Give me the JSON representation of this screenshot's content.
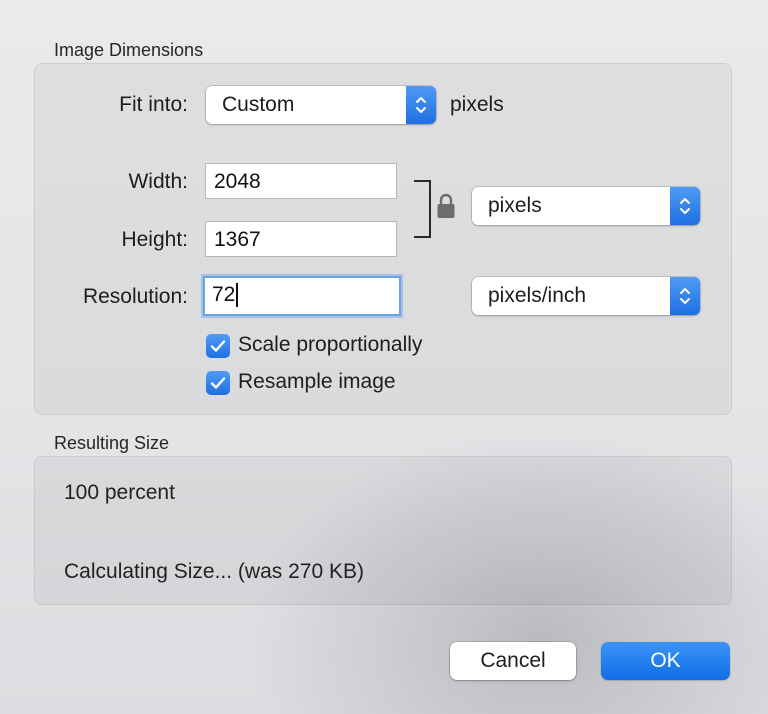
{
  "image_dimensions": {
    "title": "Image Dimensions",
    "fit_into": {
      "label": "Fit into:",
      "value": "Custom",
      "unit": "pixels"
    },
    "width": {
      "label": "Width:",
      "value": "2048"
    },
    "height": {
      "label": "Height:",
      "value": "1367"
    },
    "size_unit": "pixels",
    "resolution": {
      "label": "Resolution:",
      "value": "72",
      "unit": "pixels/inch"
    },
    "scale_proportionally": {
      "label": "Scale proportionally",
      "checked": true
    },
    "resample_image": {
      "label": "Resample image",
      "checked": true
    }
  },
  "resulting_size": {
    "title": "Resulting Size",
    "percent": "100 percent",
    "size_text": "Calculating Size... (was 270 KB)"
  },
  "buttons": {
    "cancel": "Cancel",
    "ok": "OK"
  },
  "colors": {
    "accent": "#1f6fe3",
    "focus_ring": "#6aa4e6"
  }
}
